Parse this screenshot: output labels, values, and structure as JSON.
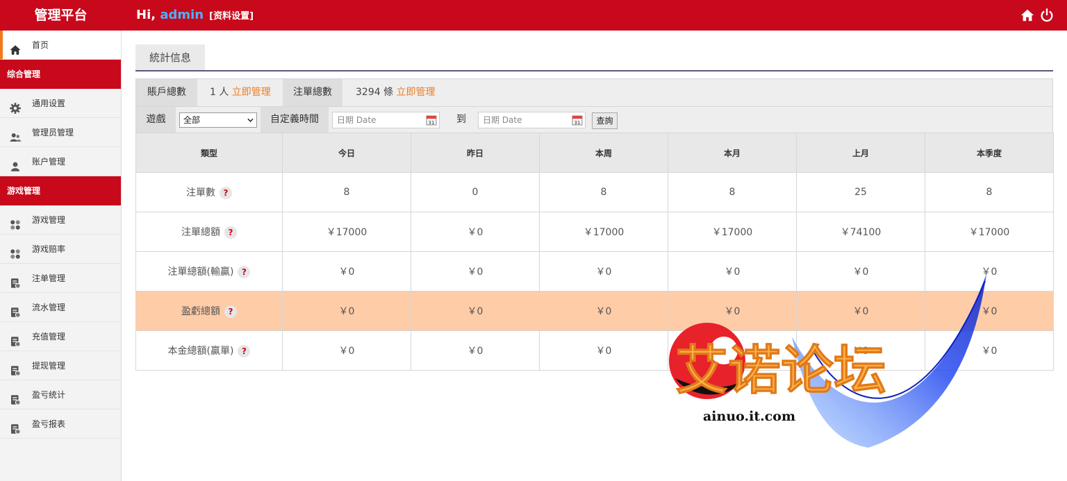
{
  "header": {
    "brand": "管理平台",
    "greeting": "Hi, ",
    "username": "admin",
    "profile_link": "[资料设置]",
    "icons": [
      "home-icon",
      "power-icon"
    ]
  },
  "sidebar": {
    "home": {
      "label": "首页",
      "icon": "home-icon"
    },
    "sections": [
      {
        "title": "综合管理",
        "items": [
          {
            "label": "通用设置",
            "icon": "gear-icon"
          },
          {
            "label": "管理员管理",
            "icon": "users-icon"
          },
          {
            "label": "账户管理",
            "icon": "user-icon"
          }
        ]
      },
      {
        "title": "游戏管理",
        "items": [
          {
            "label": "游戏管理",
            "icon": "grid-icon"
          },
          {
            "label": "游戏赔率",
            "icon": "grid-icon"
          },
          {
            "label": "注单管理",
            "icon": "doc-icon"
          },
          {
            "label": "流水管理",
            "icon": "doc-icon"
          },
          {
            "label": "充值管理",
            "icon": "doc-icon"
          },
          {
            "label": "提现管理",
            "icon": "doc-icon"
          },
          {
            "label": "盈亏统计",
            "icon": "doc-icon"
          },
          {
            "label": "盈亏报表",
            "icon": "doc-icon"
          }
        ]
      }
    ]
  },
  "main": {
    "tab": "統計信息",
    "summary": {
      "accounts_label": "賬戶總數",
      "accounts_value": "1 人",
      "accounts_link": "立即管理",
      "bets_label": "注單總數",
      "bets_value": "3294 條",
      "bets_link": "立即管理"
    },
    "filters": {
      "game_label": "遊戲",
      "game_selected": "全部",
      "time_label": "自定義時間",
      "date_placeholder": "日期 Date",
      "to_label": "到",
      "query_button": "查詢"
    },
    "table": {
      "columns": [
        "類型",
        "今日",
        "昨日",
        "本周",
        "本月",
        "上月",
        "本季度"
      ],
      "rows": [
        {
          "label": "注單數",
          "values": [
            "8",
            "0",
            "8",
            "8",
            "25",
            "8"
          ],
          "highlight": false
        },
        {
          "label": "注單總額",
          "values": [
            "￥17000",
            "￥0",
            "￥17000",
            "￥17000",
            "￥74100",
            "￥17000"
          ],
          "highlight": false
        },
        {
          "label": "注單總額(輸贏)",
          "values": [
            "￥0",
            "￥0",
            "￥0",
            "￥0",
            "￥0",
            "￥0"
          ],
          "highlight": false
        },
        {
          "label": "盈虧總額",
          "values": [
            "￥0",
            "￥0",
            "￥0",
            "￥0",
            "￥0",
            "￥0"
          ],
          "highlight": true
        },
        {
          "label": "本金總額(贏單)",
          "values": [
            "￥0",
            "￥0",
            "￥0",
            "￥0",
            "￥0",
            "￥0"
          ],
          "highlight": false
        }
      ],
      "help_glyph": "?"
    }
  },
  "watermark": {
    "title": "艾诺论坛",
    "site": "ainuo.it.com"
  },
  "colors": {
    "brand_red": "#c8081b",
    "accent_orange": "#f07b1d",
    "highlight_row": "#ffcca8",
    "username_blue": "#4ab3ff"
  }
}
